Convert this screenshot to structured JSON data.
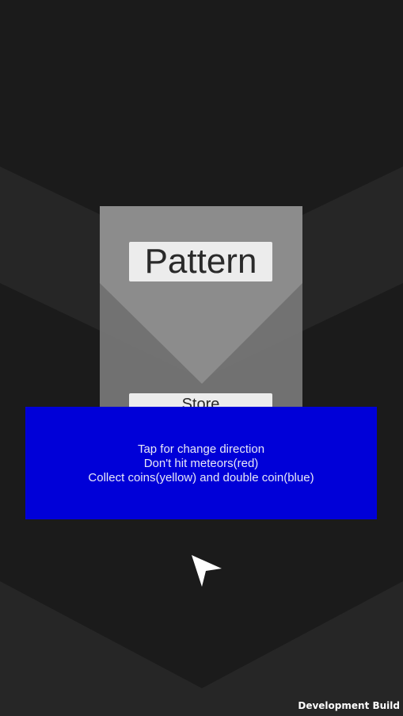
{
  "game": {
    "title": "Pattern",
    "store_label": "Store",
    "instructions": [
      "Tap for change direction",
      "Don't hit meteors(red)",
      "Collect coins(yellow) and double coin(blue)"
    ],
    "build_label": "Development Build"
  },
  "colors": {
    "background": "#1b1b1b",
    "chevron": "#262626",
    "panel": "#808080",
    "instructions_panel": "#0000d8",
    "label_background": "#ececec",
    "ship": "#ffffff"
  },
  "icons": {
    "player": "arrowhead-ship-icon"
  }
}
